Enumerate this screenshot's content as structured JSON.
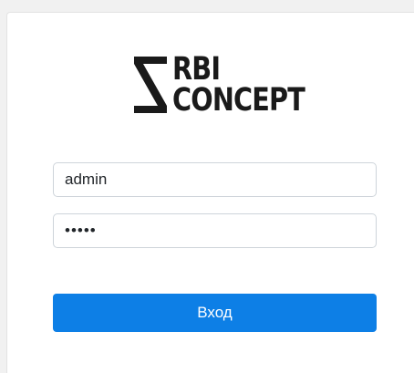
{
  "brand": {
    "line1": "RBI",
    "line2": "CONCEPT",
    "logo_icon": "hourglass-logo-icon",
    "color": "#1a1a1a"
  },
  "login_form": {
    "username_value": "admin",
    "password_value": "•••••",
    "submit_label": "Вход",
    "accent_color": "#0d7fe6"
  }
}
